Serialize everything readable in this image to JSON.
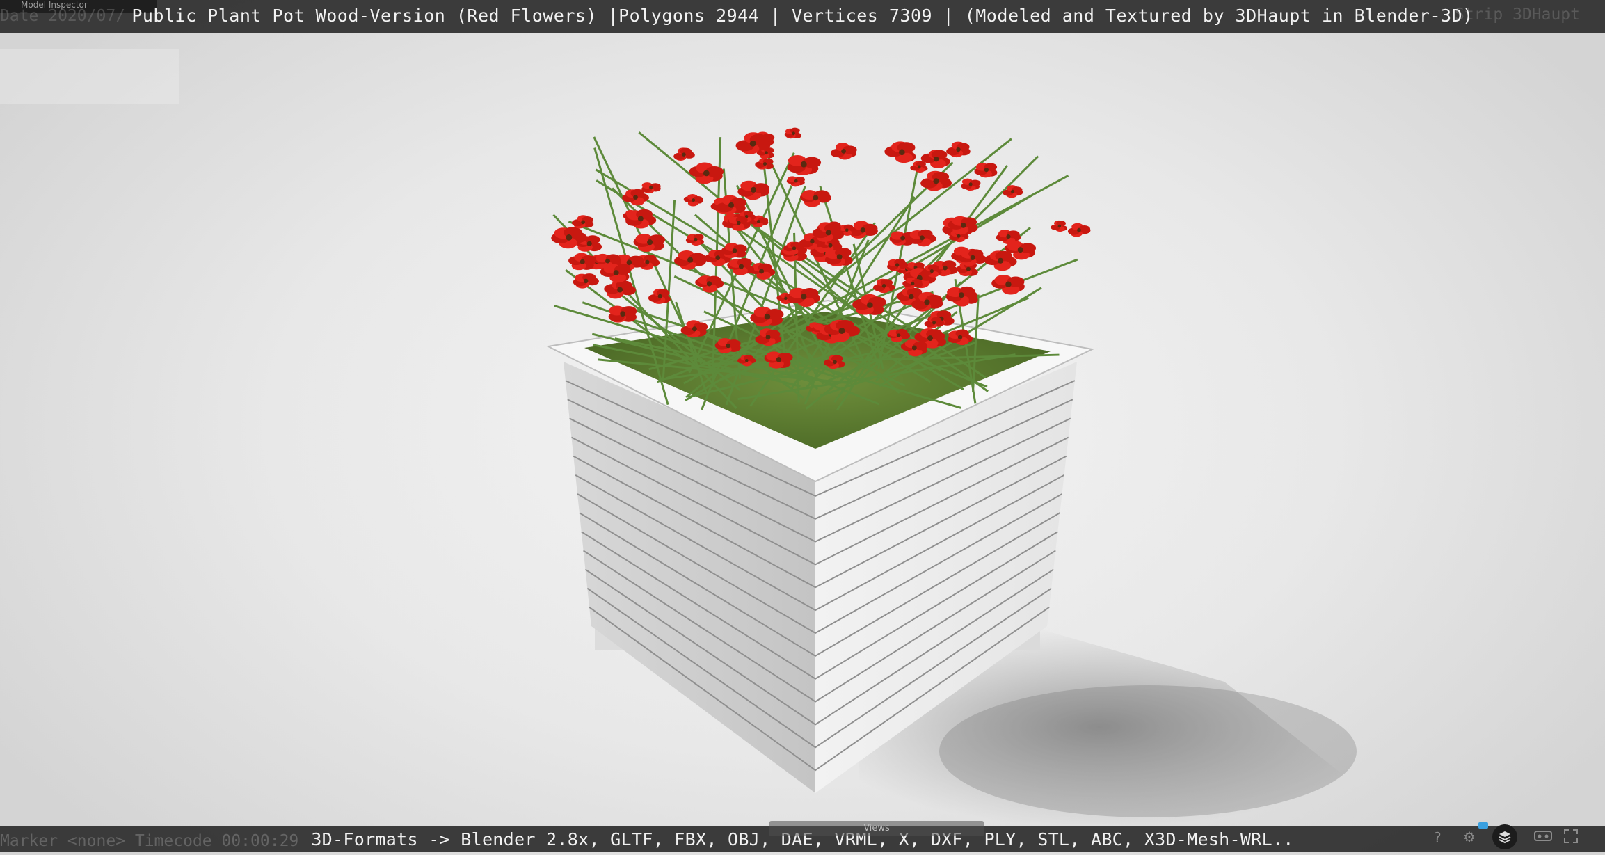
{
  "viewer": {
    "title": "Public Plant Pot Wood-Version (Red Flowers) |Polygons 2944 | Vertices 7309 | (Modeled and Textured by 3DHaupt in Blender-3D)",
    "formats": "3D-Formats -> Blender 2.8x, GLTF, FBX, OBJ, DAE, VRML, X, DXF, PLY, STL, ABC, X3D-Mesh-WRL..",
    "inspector_label": "Model Inspector",
    "ghost_date": "Date 2020/07/",
    "ghost_strip": "Strip 3DHaupt",
    "ghost_marker": "Marker <none>  Timecode 00:00:29",
    "views_label": "Views"
  },
  "icons": {
    "help": "help-icon",
    "settings": "gear-icon",
    "layers": "layers-icon",
    "vr": "vr-headset-icon",
    "fullscreen": "fullscreen-icon"
  },
  "colors": {
    "bar_bg": "#2e2e2e",
    "flower_red": "#e3241c",
    "planter_white": "#e6e6e6",
    "accent_blue": "#3aa0e0"
  }
}
